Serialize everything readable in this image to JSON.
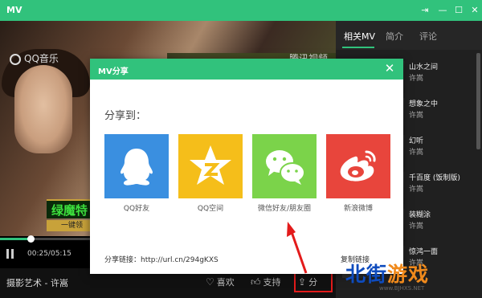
{
  "window": {
    "title": "MV",
    "controls": [
      "pin-icon",
      "minimize-icon",
      "maximize-icon",
      "close-icon"
    ]
  },
  "video": {
    "qq_logo": "QQ音乐",
    "tencent_logo": "腾讯视频",
    "banner_text": "绿魔特",
    "banner_sub": "一键领",
    "progress_fraction": 0.09,
    "time": "00:25/05:15"
  },
  "bottom_bar": {
    "song_title": "摄影艺术 - 许嵩",
    "like_label": "喜欢",
    "support_label": "支持",
    "share_label": "分"
  },
  "side": {
    "tabs": [
      {
        "label": "相关MV",
        "active": true
      },
      {
        "label": "简介",
        "active": false
      },
      {
        "label": "评论",
        "active": false
      }
    ],
    "items": [
      {
        "name": "山水之间",
        "artist": "许嵩"
      },
      {
        "name": "想象之中",
        "artist": "许嵩"
      },
      {
        "name": "幻听",
        "artist": "许嵩"
      },
      {
        "name": "千百度 (饭制版)",
        "artist": "许嵩"
      },
      {
        "name": "装糊涂",
        "artist": "许嵩"
      },
      {
        "name": "惊鸿一面",
        "artist": "许嵩"
      }
    ]
  },
  "modal": {
    "title": "MV分享",
    "share_to": "分享到：",
    "platforms": [
      {
        "label": "QQ好友",
        "color": "#3a8fe0",
        "icon": "qq-penguin-icon"
      },
      {
        "label": "QQ空间",
        "color": "#f5be1a",
        "icon": "qzone-star-icon"
      },
      {
        "label": "微信好友/朋友圈",
        "color": "#7bd34a",
        "icon": "wechat-icon"
      },
      {
        "label": "新浪微博",
        "color": "#e8453c",
        "icon": "weibo-icon"
      }
    ],
    "share_link": "分享链接：http://url.cn/294gKXS",
    "copy_link": "复制链接"
  },
  "watermark": {
    "main_blue": "北街",
    "main_orange": "游戏",
    "url": "www.BJHXS.NET"
  },
  "colors": {
    "accent": "#31c27c",
    "highlight": "#e31b1b"
  }
}
